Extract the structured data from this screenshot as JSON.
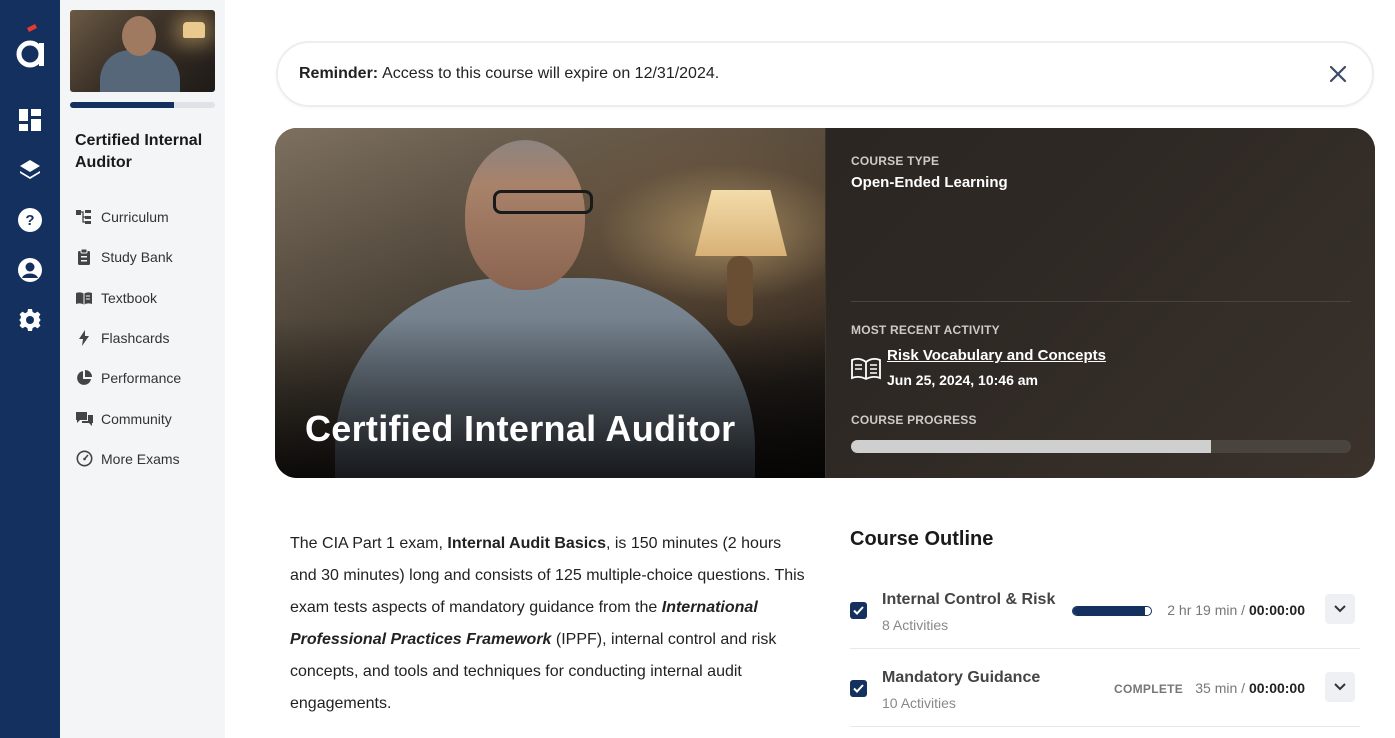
{
  "rail": {
    "icons": [
      "logo",
      "dashboard-icon",
      "layers-icon",
      "help-icon",
      "account-icon",
      "settings-icon"
    ],
    "accent": "#14305f"
  },
  "sidebar": {
    "course_name": "Certified Internal Auditor",
    "progress_fraction": 0.72,
    "items": [
      {
        "label": "Curriculum",
        "icon": "curriculum-icon"
      },
      {
        "label": "Study Bank",
        "icon": "study-bank-icon"
      },
      {
        "label": "Textbook",
        "icon": "textbook-icon"
      },
      {
        "label": "Flashcards",
        "icon": "flashcards-icon"
      },
      {
        "label": "Performance",
        "icon": "performance-icon"
      },
      {
        "label": "Community",
        "icon": "community-icon"
      },
      {
        "label": "More Exams",
        "icon": "more-exams-icon"
      }
    ]
  },
  "reminder": {
    "label": "Reminder:",
    "text": "Access to this course will expire on 12/31/2024."
  },
  "hero": {
    "title": "Certified Internal Auditor",
    "course_type_label": "COURSE TYPE",
    "course_type": "Open-Ended Learning",
    "recent_label": "MOST RECENT ACTIVITY",
    "recent_activity": "Risk Vocabulary and Concepts",
    "recent_date": "Jun 25, 2024, 10:46 am",
    "progress_label": "COURSE PROGRESS",
    "progress_fraction": 0.72
  },
  "description": {
    "p1": "The CIA Part 1 exam, ",
    "bold": "Internal Audit Basics",
    "p2": ", is 150 minutes (2 hours and 30 minutes) long and consists of 125 multiple-choice questions. This exam tests aspects of mandatory guidance from the ",
    "italic": "International Professional Practices Framework",
    "p3": " (IPPF), internal control and risk concepts, and tools and techniques for conducting internal audit engagements."
  },
  "outline": {
    "title": "Course Outline",
    "rows": [
      {
        "name": "Internal Control & Risk",
        "activities": "8 Activities",
        "progress_fraction": 0.92,
        "status": "",
        "duration": "2 hr 19 min / ",
        "elapsed": "00:00:00"
      },
      {
        "name": "Mandatory Guidance",
        "activities": "10 Activities",
        "progress_fraction": 1,
        "status": "COMPLETE",
        "duration": "35 min / ",
        "elapsed": "00:00:00"
      }
    ]
  }
}
